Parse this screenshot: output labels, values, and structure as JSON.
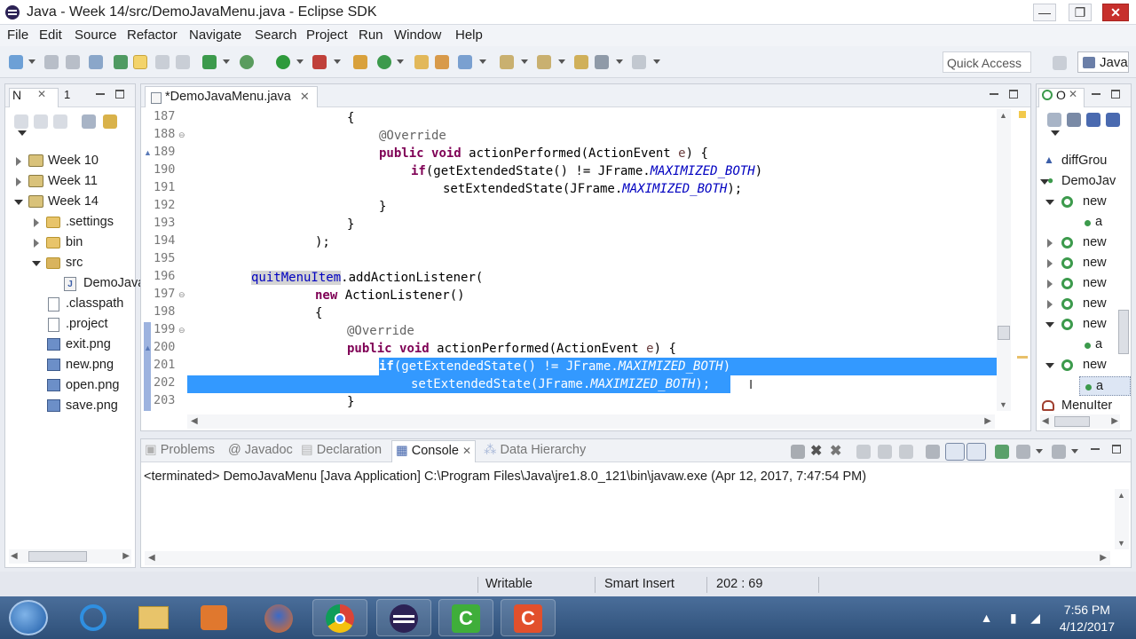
{
  "window": {
    "title": "Java - Week 14/src/DemoJavaMenu.java - Eclipse SDK",
    "minimize": "—",
    "maximize": "❐",
    "close": "✕"
  },
  "menu": [
    "File",
    "Edit",
    "Source",
    "Refactor",
    "Navigate",
    "Search",
    "Project",
    "Run",
    "Window",
    "Help"
  ],
  "toolbar": {
    "quick_access_placeholder": "Quick Access",
    "perspective": "Java"
  },
  "explorer": {
    "tabs": [
      "N",
      "1"
    ],
    "items": [
      {
        "label": "Week 10"
      },
      {
        "label": "Week 11"
      },
      {
        "label": "Week 14"
      },
      {
        "label": ".settings"
      },
      {
        "label": "bin"
      },
      {
        "label": "src"
      },
      {
        "label": "DemoJava"
      },
      {
        "label": ".classpath"
      },
      {
        "label": ".project"
      },
      {
        "label": "exit.png"
      },
      {
        "label": "new.png"
      },
      {
        "label": "open.png"
      },
      {
        "label": "save.png"
      }
    ]
  },
  "editor": {
    "tab_label": "*DemoJavaMenu.java",
    "lines": [
      "187",
      "188",
      "189",
      "190",
      "191",
      "192",
      "193",
      "194",
      "195",
      "196",
      "197",
      "198",
      "199",
      "200",
      "201",
      "202",
      "203"
    ]
  },
  "outline": {
    "tab": "O",
    "items": [
      "diffGrou",
      "DemoJav",
      "new",
      "a",
      "new",
      "new",
      "new",
      "new",
      "new",
      "a",
      "new",
      "a",
      "MenuIter"
    ]
  },
  "console": {
    "tabs": [
      "Problems",
      "Javadoc",
      "Declaration",
      "Console",
      "Data Hierarchy"
    ],
    "text": "<terminated> DemoJavaMenu [Java Application] C:\\Program Files\\Java\\jre1.8.0_121\\bin\\javaw.exe (Apr 12, 2017, 7:47:54 PM)"
  },
  "status": {
    "writable": "Writable",
    "insert_mode": "Smart Insert",
    "position": "202 : 69"
  },
  "taskbar": {
    "time": "7:56 PM",
    "date": "4/12/2017"
  }
}
